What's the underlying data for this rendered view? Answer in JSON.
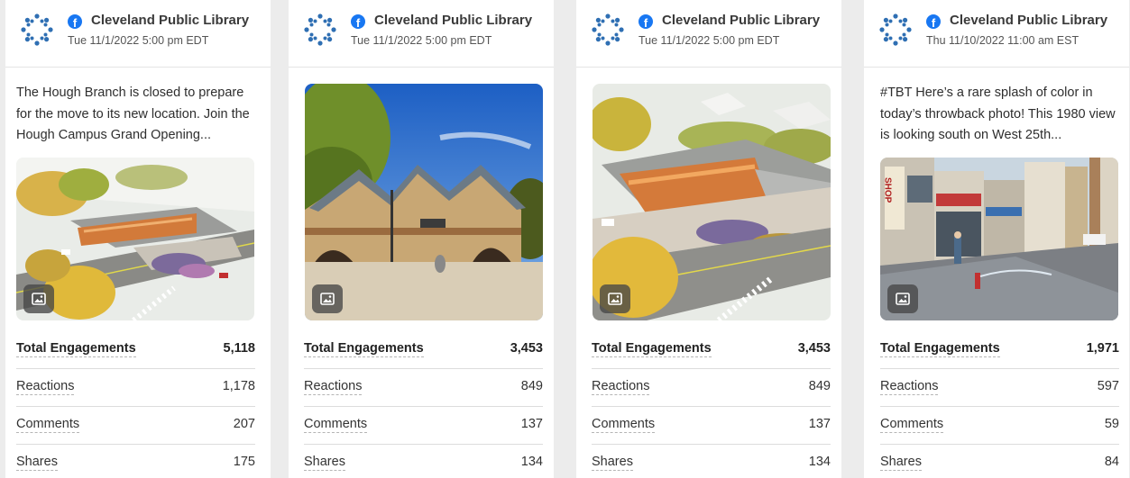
{
  "cards": [
    {
      "page_name": "Cleveland Public Library",
      "timestamp": "Tue 11/1/2022 5:00 pm EDT",
      "post_text": "The Hough Branch is closed to prepare for the move to its new location. Join the Hough Campus Grand Opening...",
      "image_icon": "image-icon",
      "metrics": [
        {
          "label": "Total Engagements",
          "value": "5,118"
        },
        {
          "label": "Reactions",
          "value": "1,178"
        },
        {
          "label": "Comments",
          "value": "207"
        },
        {
          "label": "Shares",
          "value": "175"
        }
      ]
    },
    {
      "page_name": "Cleveland Public Library",
      "timestamp": "Tue 11/1/2022 5:00 pm EDT",
      "post_text": "",
      "image_icon": "image-icon",
      "metrics": [
        {
          "label": "Total Engagements",
          "value": "3,453"
        },
        {
          "label": "Reactions",
          "value": "849"
        },
        {
          "label": "Comments",
          "value": "137"
        },
        {
          "label": "Shares",
          "value": "134"
        }
      ]
    },
    {
      "page_name": "Cleveland Public Library",
      "timestamp": "Tue 11/1/2022 5:00 pm EDT",
      "post_text": "",
      "image_icon": "image-icon",
      "metrics": [
        {
          "label": "Total Engagements",
          "value": "3,453"
        },
        {
          "label": "Reactions",
          "value": "849"
        },
        {
          "label": "Comments",
          "value": "137"
        },
        {
          "label": "Shares",
          "value": "134"
        }
      ]
    },
    {
      "page_name": "Cleveland Public Library",
      "timestamp": "Thu 11/10/2022 11:00 am EST",
      "post_text": "#TBT Here’s a rare splash of color in today’s throwback photo! This 1980 view is looking south on West 25th...",
      "image_icon": "image-icon",
      "image_sign_text": "SHOP",
      "metrics": [
        {
          "label": "Total Engagements",
          "value": "1,971"
        },
        {
          "label": "Reactions",
          "value": "597"
        },
        {
          "label": "Comments",
          "value": "59"
        },
        {
          "label": "Shares",
          "value": "84"
        }
      ]
    }
  ],
  "colors": {
    "facebook_blue": "#1877f2",
    "logo_blue": "#2f6fb3",
    "card_bg": "#ffffff",
    "page_bg": "#ececec"
  }
}
